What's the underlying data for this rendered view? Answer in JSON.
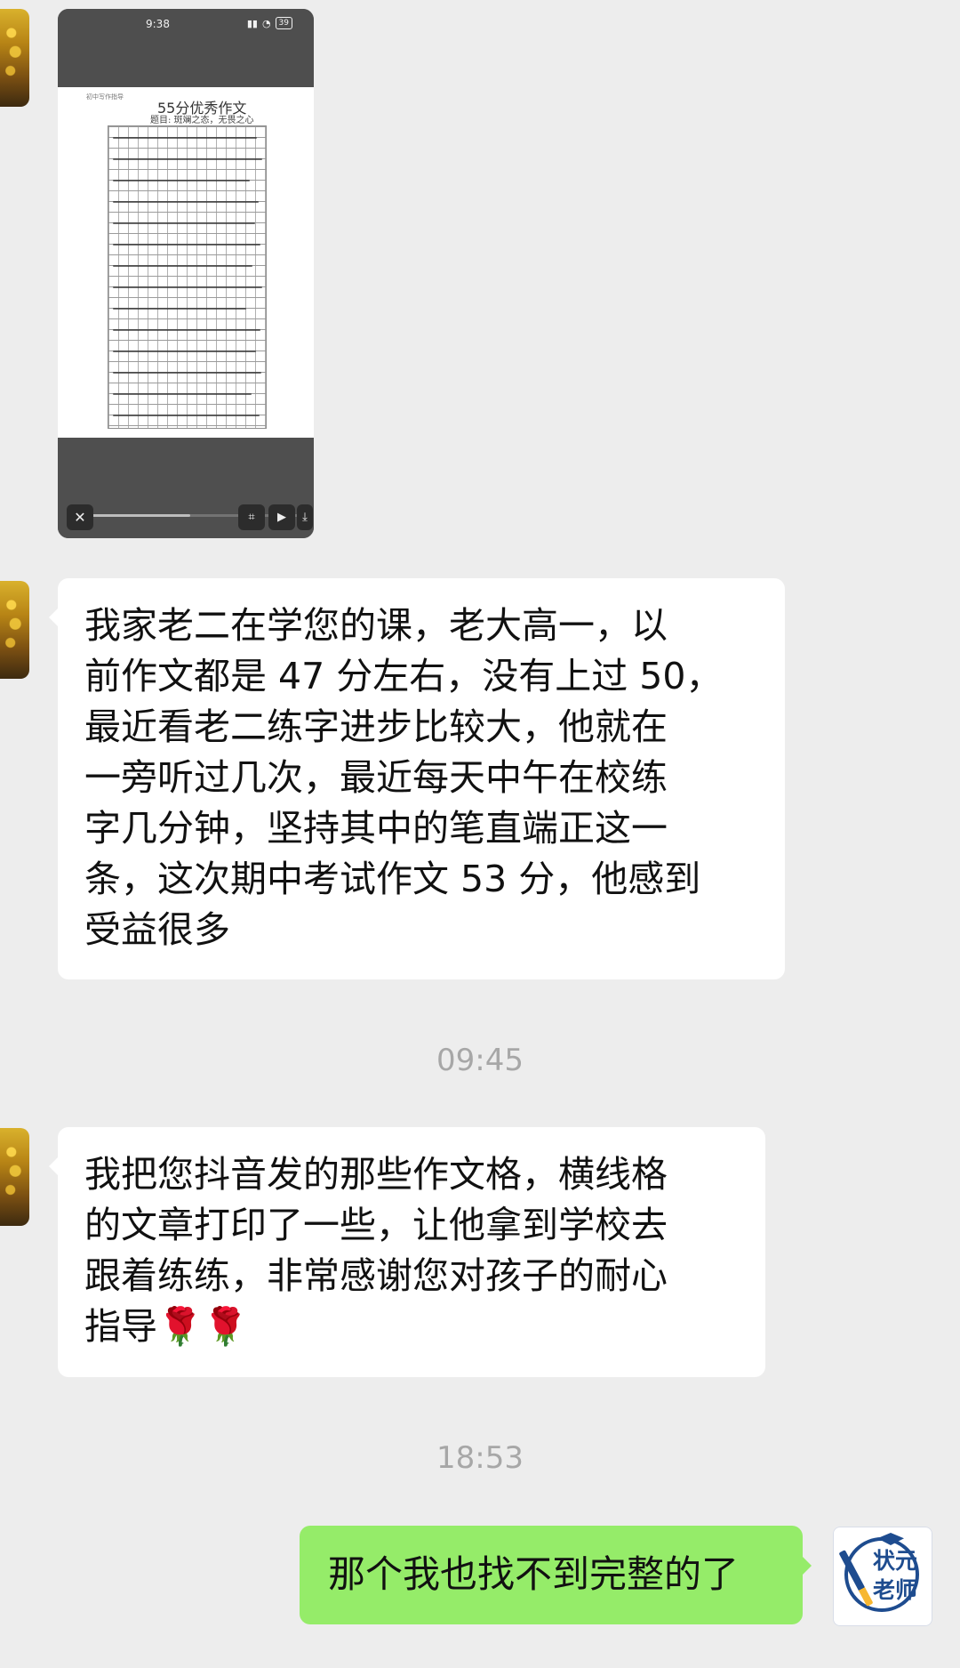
{
  "video": {
    "status_time": "9:38",
    "battery": "39",
    "paper_header": "初中写作指导",
    "paper_title": "55分优秀作文",
    "paper_subtitle": "题目: 斑斓之态，无畏之心",
    "progress_percent": 52,
    "controls": {
      "close": "✕",
      "scan": "⌗",
      "play": "▶",
      "download": "⤓"
    }
  },
  "messages": [
    {
      "id": "msg1",
      "text": "我家老二在学您的课，老大高一，以\n前作文都是 47 分左右，没有上过 50，\n最近看老二练字进步比较大，他就在\n一旁听过几次，最近每天中午在校练\n字几分钟，坚持其中的笔直端正这一\n条，这次期中考试作文 53 分，他感到\n受益很多"
    },
    {
      "id": "time1",
      "text": "09:45"
    },
    {
      "id": "msg2",
      "text": "我把您抖音发的那些作文格，横线格\n的文章打印了一些，让他拿到学校去\n跟着练练，非常感谢您对孩子的耐心\n指导🌹🌹"
    },
    {
      "id": "time2",
      "text": "18:53"
    },
    {
      "id": "msg3",
      "text": "那个我也找不到完整的了"
    }
  ],
  "teacher_logo": {
    "line1": "状元",
    "line2": "老师",
    "color": "#1e4c8f"
  }
}
